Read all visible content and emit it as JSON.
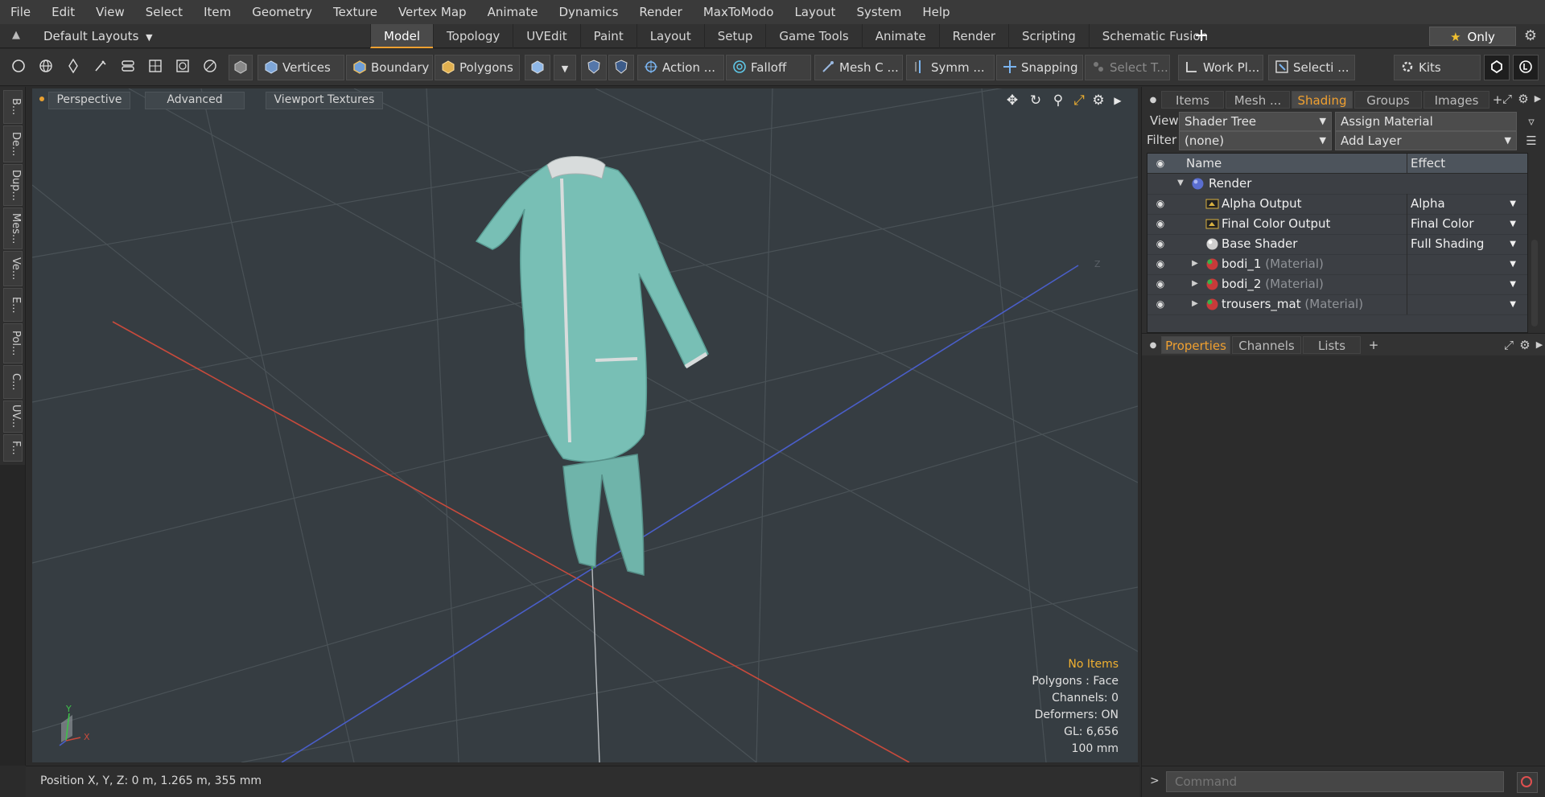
{
  "menu": [
    "File",
    "Edit",
    "View",
    "Select",
    "Item",
    "Geometry",
    "Texture",
    "Vertex Map",
    "Animate",
    "Dynamics",
    "Render",
    "MaxToModo",
    "Layout",
    "System",
    "Help"
  ],
  "layout": {
    "preset": "Default Layouts",
    "tabs": [
      "Model",
      "Topology",
      "UVEdit",
      "Paint",
      "Layout",
      "Setup",
      "Game Tools",
      "Animate",
      "Render",
      "Scripting",
      "Schematic Fusion"
    ],
    "active_tab": "Model",
    "add_symbol": "+",
    "only_label": "Only"
  },
  "toolbar": {
    "vertices": "Vertices",
    "boundary": "Boundary",
    "polygons": "Polygons",
    "action": "Action",
    "action_more": "...",
    "falloff": "Falloff",
    "mesh": "Mesh C ...",
    "symm": "Symm ...",
    "snapping": "Snapping",
    "select_t": "Select T...",
    "work_plane": "Work Pl...",
    "selecti": "Selecti ...",
    "kits": "Kits"
  },
  "left_tabs": [
    "B...",
    "De...",
    "Dup...",
    "Mes...",
    "Ve...",
    "E...",
    "Pol...",
    "C...",
    "UV...",
    "F..."
  ],
  "viewport": {
    "perspective": "Perspective",
    "advanced": "Advanced",
    "viewport_textures": "Viewport Textures",
    "info": {
      "items": "No Items",
      "polygons": "Polygons : Face",
      "channels": "Channels: 0",
      "deformers": "Deformers: ON",
      "gl": "GL: 6,656",
      "scale": "100 mm"
    },
    "axis_y": "Y",
    "axis_x": "X",
    "axis_z": "Z"
  },
  "status": {
    "position": "Position X, Y, Z:   0 m, 1.265 m, 355 mm"
  },
  "shading_panel": {
    "tabs": [
      "Items",
      "Mesh ...",
      "Shading",
      "Groups",
      "Images"
    ],
    "active_tab": "Shading",
    "view_label": "View",
    "view_value": "Shader Tree",
    "assign_material": "Assign Material",
    "filter_label": "Filter",
    "filter_value": "(none)",
    "add_layer": "Add Layer",
    "columns": {
      "name": "Name",
      "effect": "Effect"
    },
    "rows": [
      {
        "name": "Render",
        "sub": "",
        "effect": "",
        "level": 0
      },
      {
        "name": "Alpha Output",
        "sub": "",
        "effect": "Alpha",
        "level": 1
      },
      {
        "name": "Final Color Output",
        "sub": "",
        "effect": "Final Color",
        "level": 1
      },
      {
        "name": "Base Shader",
        "sub": "",
        "effect": "Full Shading",
        "level": 1
      },
      {
        "name": "bodi_1",
        "sub": "(Material)",
        "effect": "",
        "level": 1
      },
      {
        "name": "bodi_2",
        "sub": "(Material)",
        "effect": "",
        "level": 1
      },
      {
        "name": "trousers_mat",
        "sub": "(Material)",
        "effect": "",
        "level": 1
      }
    ]
  },
  "properties_panel": {
    "tabs": [
      "Properties",
      "Channels",
      "Lists"
    ],
    "active_tab": "Properties",
    "add_symbol": "+"
  },
  "command": {
    "placeholder": "Command",
    "prompt": ">"
  },
  "colors": {
    "accent": "#f0a030",
    "viewport_bg": "#363d42",
    "model": "#78bfb5",
    "axis_x": "#c84a3c",
    "axis_z": "#4a5ec8",
    "axis_y": "#3ec04a"
  }
}
